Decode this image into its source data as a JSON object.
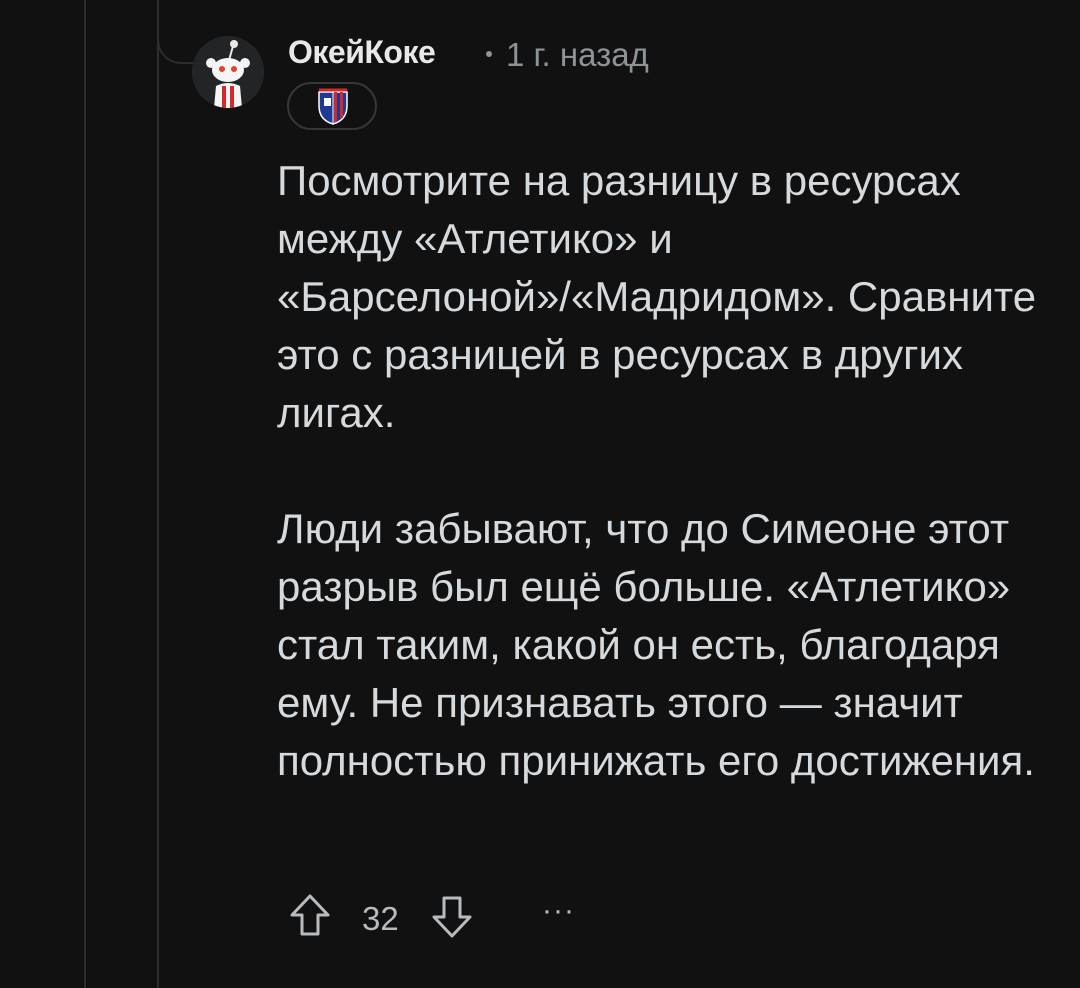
{
  "comment": {
    "author": "ОкейКоке",
    "age": "1 г. назад",
    "flair": "atletico-madrid-crest",
    "paragraphs": [
      "Посмотрите на разницу в ресурсах между «Атлетико» и «Барселоной»/«Мадридом». Сравните это с разницей в ресурсах в других лигах.",
      "Люди забывают, что до Симеоне этот разрыв был ещё больше. «Атлетико» стал таким, какой он есть, благодаря ему. Не признавать этого — значит полностью принижать его достижения."
    ]
  },
  "actions": {
    "score": "32",
    "more": "···"
  },
  "icons": {
    "upvote": "arrow-up-icon",
    "downvote": "arrow-down-icon",
    "more": "more-icon"
  },
  "colors": {
    "background": "#111112",
    "text": "#d7dadc",
    "muted": "#8e9396",
    "thread_line": "#2b2e30"
  }
}
